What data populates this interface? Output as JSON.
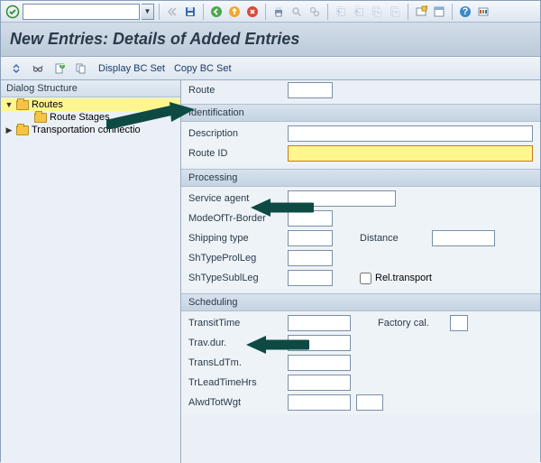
{
  "title": "New Entries: Details of Added Entries",
  "toolbar2": {
    "display_bc": "Display BC Set",
    "copy_bc": "Copy BC Set"
  },
  "tree": {
    "header": "Dialog Structure",
    "routes": "Routes",
    "route_stages": "Route Stages",
    "transport": "Transportation connectio"
  },
  "form": {
    "route_lbl": "Route",
    "route_val": "",
    "identification": "Identification",
    "description_lbl": "Description",
    "description_val": "",
    "route_id_lbl": "Route ID",
    "route_id_val": "",
    "processing": "Processing",
    "service_agent_lbl": "Service agent",
    "service_agent_val": "",
    "mode_lbl": "ModeOfTr-Border",
    "mode_val": "",
    "shipping_type_lbl": "Shipping type",
    "shipping_type_val": "",
    "distance_lbl": "Distance",
    "distance_val": "",
    "shtype_prol_lbl": "ShTypeProlLeg",
    "shtype_prol_val": "",
    "shtype_subl_lbl": "ShTypeSublLeg",
    "shtype_subl_val": "",
    "rel_transport_lbl": "Rel.transport",
    "scheduling": "Scheduling",
    "transit_lbl": "TransitTime",
    "transit_val": "",
    "factory_cal_lbl": "Factory cal.",
    "factory_cal_val": "",
    "trav_dur_lbl": "Trav.dur.",
    "trav_dur_val": "",
    "translu_lbl": "TransLdTm.",
    "translu_val": "",
    "trlead_lbl": "TrLeadTimeHrs",
    "trlead_val": "",
    "alwd_lbl": "AlwdTotWgt",
    "alwd_val": "",
    "alwd_unit_val": ""
  }
}
